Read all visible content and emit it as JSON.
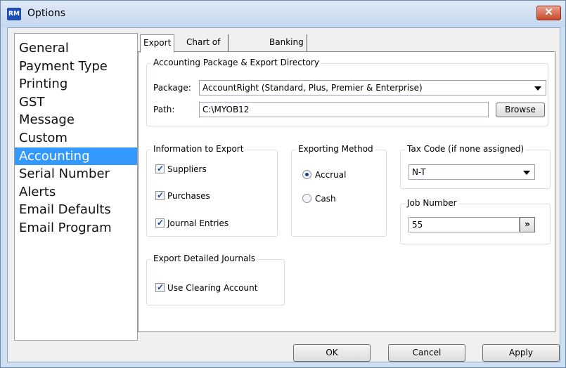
{
  "window": {
    "title": "Options",
    "icon_text": "RM",
    "close_glyph": "✕"
  },
  "nav": {
    "items": [
      {
        "label": "General"
      },
      {
        "label": "Payment Type"
      },
      {
        "label": "Printing"
      },
      {
        "label": "GST"
      },
      {
        "label": "Message"
      },
      {
        "label": "Custom"
      },
      {
        "label": "Accounting",
        "selected": true
      },
      {
        "label": "Serial Number"
      },
      {
        "label": "Alerts"
      },
      {
        "label": "Email Defaults"
      },
      {
        "label": "Email Program"
      }
    ]
  },
  "tabs": [
    {
      "label": "Export",
      "active": true
    },
    {
      "label": "Chart of Accounts"
    },
    {
      "label": "Banking Export"
    }
  ],
  "export": {
    "package_group": {
      "title": "Accounting Package & Export Directory",
      "package_label": "Package:",
      "package_value": "AccountRight (Standard, Plus, Premier & Enterprise)",
      "path_label": "Path:",
      "path_value": "C:\\MYOB12",
      "browse_label": "Browse"
    },
    "info_group": {
      "title": "Information to Export",
      "items": [
        {
          "label": "Suppliers",
          "checked": true
        },
        {
          "label": "Purchases",
          "checked": true
        },
        {
          "label": "Journal Entries",
          "checked": true
        }
      ]
    },
    "method_group": {
      "title": "Exporting Method",
      "options": [
        {
          "label": "Accrual",
          "selected": true
        },
        {
          "label": "Cash",
          "selected": false
        }
      ]
    },
    "tax_group": {
      "title": "Tax Code (if none assigned)",
      "value": "N-T"
    },
    "job_group": {
      "title": "Job Number",
      "value": "55",
      "button_label": "»"
    },
    "journals_group": {
      "title": "Export Detailed Journals",
      "items": [
        {
          "label": "Use Clearing Account",
          "checked": true
        }
      ]
    }
  },
  "buttons": {
    "ok": "OK",
    "cancel": "Cancel",
    "apply": "Apply"
  },
  "colors": {
    "selection": "#3399ff",
    "close": "#c74a2e",
    "titlebar": "#c4d8ef"
  }
}
